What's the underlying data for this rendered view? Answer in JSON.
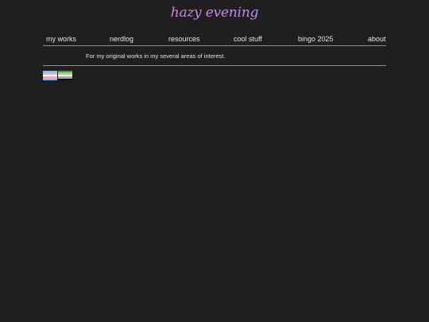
{
  "site": {
    "title": "hazy evening"
  },
  "nav": {
    "items": [
      {
        "label": "my works"
      },
      {
        "label": "nerdlog"
      },
      {
        "label": "resources"
      },
      {
        "label": "cool stuff"
      },
      {
        "label": "bingo 2025"
      },
      {
        "label": "about"
      }
    ]
  },
  "main": {
    "tagline": "For my original works in my several areas of interest."
  },
  "flags": [
    {
      "name": "transgender-flag",
      "stripes": [
        "#5bcefa",
        "#f5a9b8",
        "#ffffff",
        "#f5a9b8",
        "#5bcefa"
      ]
    },
    {
      "name": "aromantic-flag",
      "stripes": [
        "#3da542",
        "#a7d379",
        "#ffffff",
        "#a9a9a9",
        "#000000"
      ]
    }
  ],
  "colors": {
    "background": "#1f1f1f",
    "title": "#c48be6",
    "text": "#e6e6e6",
    "rule": "#8e8e8e"
  }
}
